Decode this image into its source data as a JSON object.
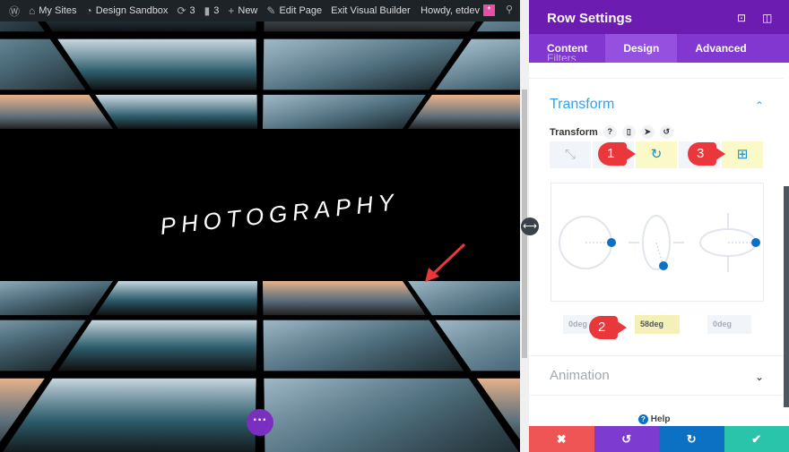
{
  "adminbar": {
    "items": [
      {
        "icon": "wordpress-icon",
        "label": ""
      },
      {
        "icon": "my-sites-icon",
        "label": "My Sites"
      },
      {
        "icon": "dashboard-icon",
        "label": "Design Sandbox"
      },
      {
        "icon": "updates-icon",
        "label": "3"
      },
      {
        "icon": "comments-icon",
        "label": "3"
      },
      {
        "icon": "plus-icon",
        "label": "New"
      },
      {
        "icon": "pencil-icon",
        "label": "Edit Page"
      },
      {
        "icon": "",
        "label": "Exit Visual Builder"
      }
    ],
    "howdy": "Howdy, etdev"
  },
  "canvas": {
    "title": "PHOTOGRAPHY"
  },
  "panel": {
    "title": "Row Settings",
    "tabs": [
      "Content",
      "Design",
      "Advanced"
    ],
    "active_tab": "Design",
    "filters_label": "Filters",
    "transform_heading": "Transform",
    "transform_label": "Transform",
    "rotation_values": [
      "0deg",
      "58deg",
      "0deg"
    ],
    "markers": [
      "1",
      "2",
      "3"
    ],
    "animation_heading": "Animation",
    "help": "Help"
  },
  "colors": {
    "accent": "#2ea3f2",
    "header": "#6c1cb0",
    "cancel": "#ef5555",
    "undo": "#7e3bd0",
    "redo": "#0c71c3",
    "save": "#29c4a9"
  }
}
